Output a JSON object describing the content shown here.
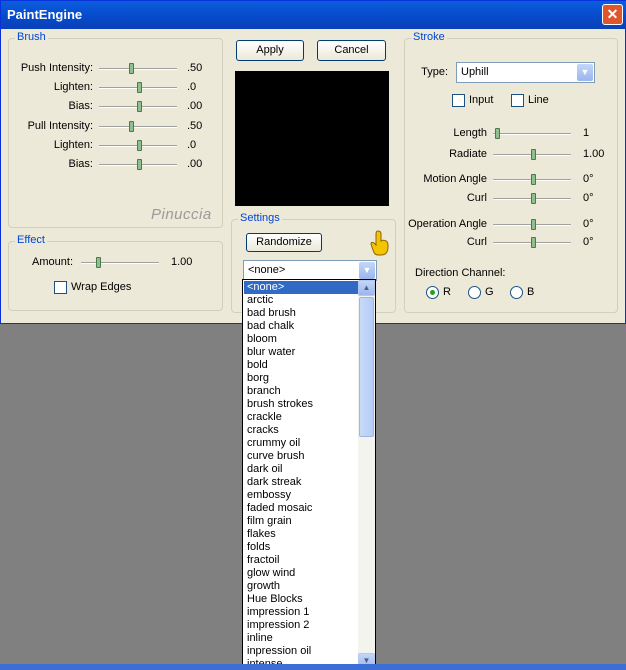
{
  "window": {
    "title": "PaintEngine",
    "close_label": "✕"
  },
  "brush": {
    "legend": "Brush",
    "rows": [
      {
        "label": "Push Intensity:",
        "value": ".50",
        "level": 0.5
      },
      {
        "label": "Lighten:",
        "value": ".0",
        "level": 0.5
      },
      {
        "label": "Bias:",
        "value": ".00",
        "level": 0.5
      },
      {
        "label": "Pull Intensity:",
        "value": ".50",
        "level": 0.5
      },
      {
        "label": "Lighten:",
        "value": ".0",
        "level": 0.5
      },
      {
        "label": "Bias:",
        "value": ".00",
        "level": 0.5
      }
    ]
  },
  "effect": {
    "legend": "Effect",
    "amount_label": "Amount:",
    "amount_value": "1.00",
    "wrap_label": "Wrap Edges"
  },
  "buttons": {
    "apply": "Apply",
    "cancel": "Cancel",
    "randomize": "Randomize"
  },
  "settings": {
    "legend": "Settings",
    "selected": "<none>"
  },
  "watermark": "Pinuccia",
  "stroke": {
    "legend": "Stroke",
    "type_label": "Type:",
    "type_value": "Uphill",
    "input_label": "Input",
    "line_label": "Line",
    "length_label": "Length",
    "length_value": "1",
    "radiate_label": "Radiate",
    "radiate_value": "1.00",
    "motion_angle_label": "Motion Angle",
    "motion_angle_value": "0°",
    "curl1_label": "Curl",
    "curl1_value": "0°",
    "operation_angle_label": "Operation Angle",
    "operation_angle_value": "0°",
    "curl2_label": "Curl",
    "curl2_value": "0°",
    "direction_label": "Direction Channel:",
    "r_label": "R",
    "g_label": "G",
    "b_label": "B"
  },
  "dropdown_items": [
    "<none>",
    "arctic",
    "bad brush",
    "bad chalk",
    "bloom",
    "blur water",
    "bold",
    "borg",
    "branch",
    "brush strokes",
    "crackle",
    "cracks",
    "crummy oil",
    "curve brush",
    "dark oil",
    "dark streak",
    "embossy",
    "faded mosaic",
    "film grain",
    "flakes",
    "folds",
    "fractoil",
    "glow wind",
    "growth",
    "Hue Blocks",
    "impression 1",
    "impression 2",
    "inline",
    "inpression oil",
    "intense"
  ],
  "icons": {
    "close": "close-icon",
    "combo_arrow": "chevron-down-icon",
    "scroll_up": "arrow-up-icon",
    "scroll_down": "arrow-down-icon",
    "pointer": "hand-pointer-icon"
  }
}
